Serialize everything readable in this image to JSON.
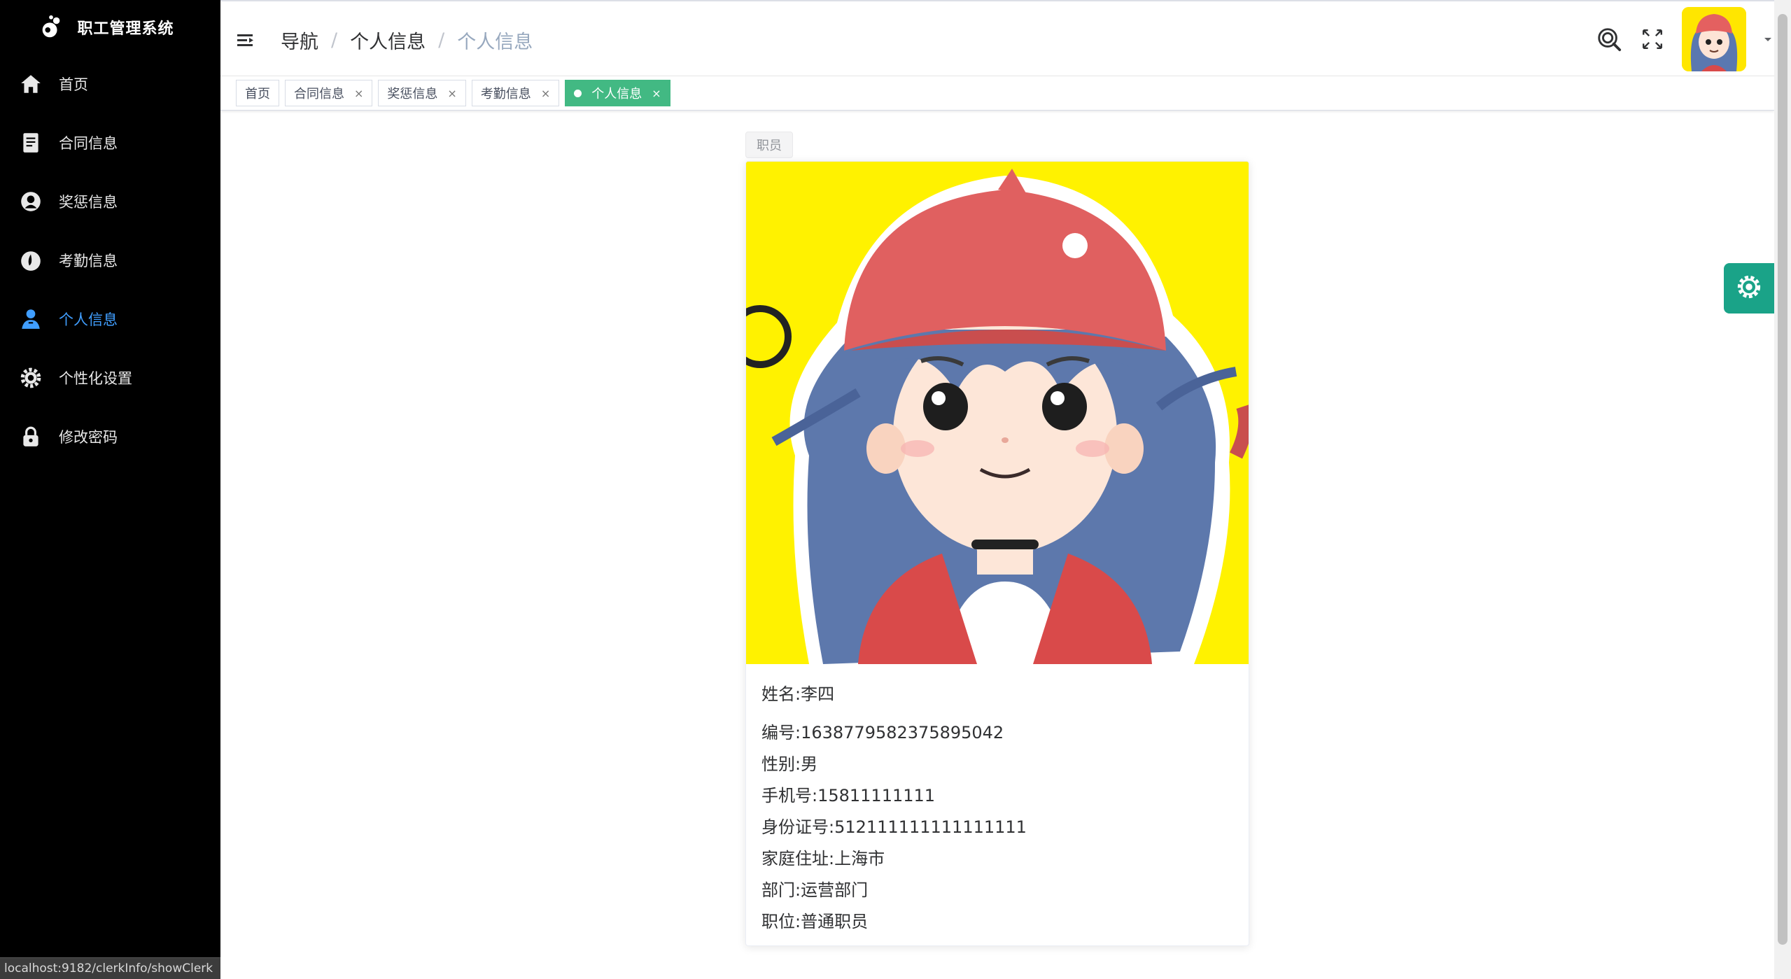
{
  "app": {
    "title": "职工管理系统"
  },
  "sidebar": {
    "items": [
      {
        "label": "首页",
        "icon": "home-icon"
      },
      {
        "label": "合同信息",
        "icon": "document-icon"
      },
      {
        "label": "奖惩信息",
        "icon": "reward-icon"
      },
      {
        "label": "考勤信息",
        "icon": "attendance-icon"
      },
      {
        "label": "个人信息",
        "icon": "user-icon",
        "active": true
      },
      {
        "label": "个性化设置",
        "icon": "gear-icon"
      },
      {
        "label": "修改密码",
        "icon": "lock-icon"
      }
    ]
  },
  "header": {
    "breadcrumb": [
      "导航",
      "个人信息",
      "个人信息"
    ]
  },
  "tags": [
    {
      "label": "首页",
      "closable": false
    },
    {
      "label": "合同信息",
      "closable": true
    },
    {
      "label": "奖惩信息",
      "closable": true
    },
    {
      "label": "考勤信息",
      "closable": true
    },
    {
      "label": "个人信息",
      "closable": true,
      "active": true
    }
  ],
  "tag_close_glyph": "×",
  "profile": {
    "role": "职员",
    "name": "姓名:李四",
    "fields": [
      "编号:1638779582375895042",
      "性别:男",
      "手机号:15811111111",
      "身份证号:512111111111111111",
      "家庭住址:上海市",
      "部门:运营部门",
      "职位:普通职员"
    ]
  },
  "status_bar": {
    "url": "localhost:9182/clerkInfo/showClerk"
  },
  "colors": {
    "sidebar_bg": "#000000",
    "active_menu": "#409EFF",
    "active_tag": "#42b983",
    "settings_button": "#1aa388",
    "portrait_bg": "#fff200"
  }
}
